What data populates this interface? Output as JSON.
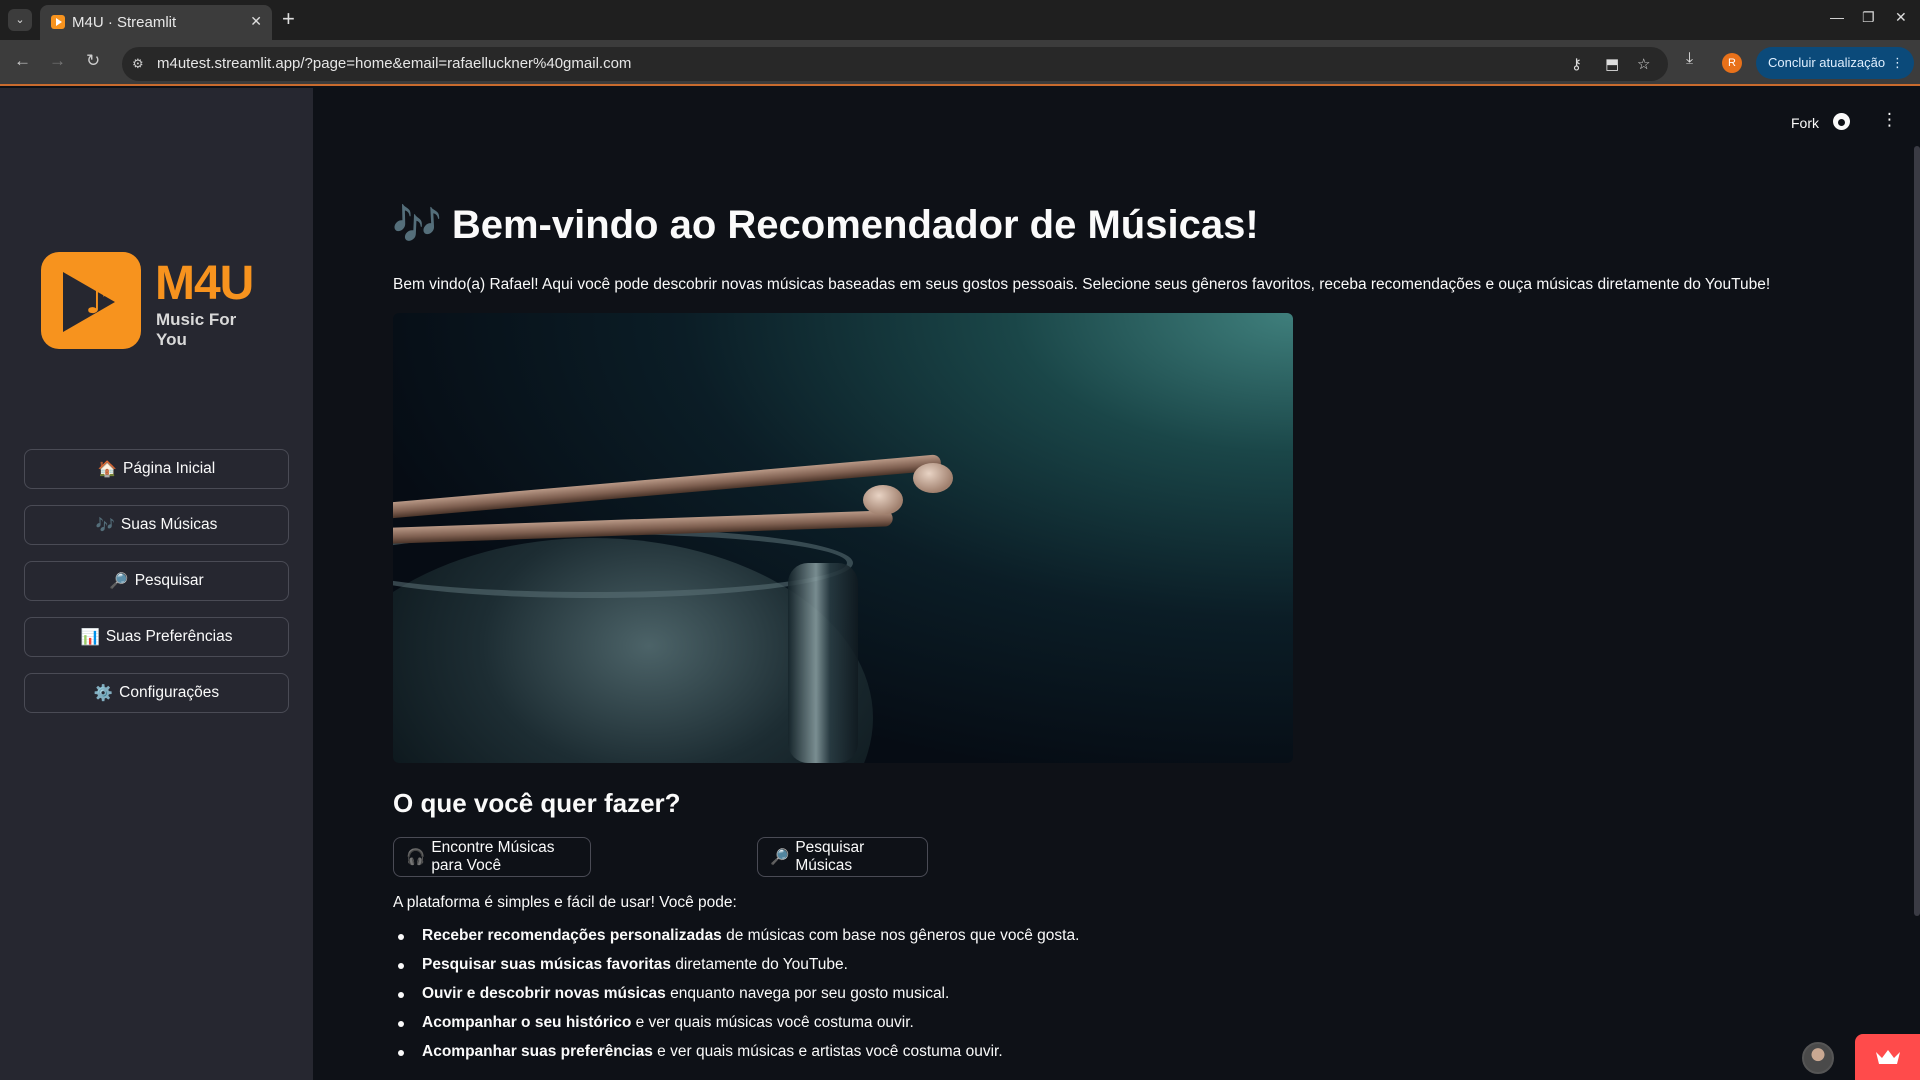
{
  "browser": {
    "tab_title": "M4U · Streamlit",
    "url": "m4utest.streamlit.app/?page=home&email=rafaelluckner%40gmail.com",
    "profile_initial": "R",
    "update_label": "Concluir atualização"
  },
  "app": {
    "header": {
      "fork_label": "Fork"
    },
    "sidebar": {
      "logo": {
        "name": "M4U",
        "tagline": "Music For You"
      },
      "items": [
        {
          "icon": "🏠",
          "label": "Página Inicial"
        },
        {
          "icon": "🎶",
          "label": "Suas Músicas"
        },
        {
          "icon": "🔎",
          "label": "Pesquisar"
        },
        {
          "icon": "📊",
          "label": "Suas Preferências"
        },
        {
          "icon": "⚙️",
          "label": "Configurações"
        }
      ]
    },
    "main": {
      "title_icon": "🎶",
      "title": "Bem-vindo ao Recomendador de Músicas!",
      "intro": "Bem vindo(a) Rafael! Aqui você pode descobrir novas músicas baseadas em seus gostos pessoais. Selecione seus gêneros favoritos, receba recomendações e ouça músicas diretamente do YouTube!",
      "section_title": "O que você quer fazer?",
      "actions": [
        {
          "icon": "🎧",
          "label": "Encontre Músicas para Você"
        },
        {
          "icon": "🔎",
          "label": "Pesquisar Músicas"
        }
      ],
      "lead": "A plataforma é simples e fácil de usar! Você pode:",
      "features": [
        {
          "bold": "Receber recomendações personalizadas",
          "rest": " de músicas com base nos gêneros que você gosta."
        },
        {
          "bold": "Pesquisar suas músicas favoritas",
          "rest": " diretamente do YouTube."
        },
        {
          "bold": "Ouvir e descobrir novas músicas",
          "rest": " enquanto navega por seu gosto musical."
        },
        {
          "bold": "Acompanhar o seu histórico",
          "rest": " e ver quais músicas você costuma ouvir."
        },
        {
          "bold": "Acompanhar suas preferências",
          "rest": " e ver quais músicas e artistas você costuma ouvir."
        }
      ]
    }
  },
  "colors": {
    "accent": "#f7931e",
    "background": "#0e1117",
    "sidebar": "#262730",
    "streamlit_red": "#ff4b4b"
  }
}
